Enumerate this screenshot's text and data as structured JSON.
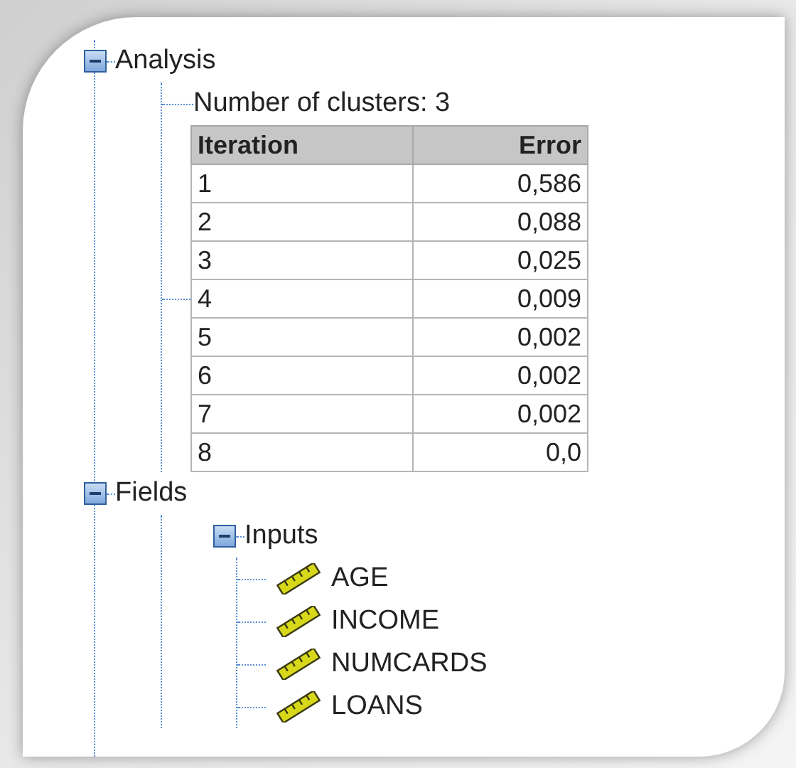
{
  "tree": [
    {
      "label": "Analysis",
      "expanded": true,
      "children": [
        {
          "kind": "text",
          "label": "Number of clusters: 3"
        },
        {
          "kind": "table",
          "columns": [
            "Iteration",
            "Error"
          ],
          "rows": [
            [
              "1",
              "0,586"
            ],
            [
              "2",
              "0,088"
            ],
            [
              "3",
              "0,025"
            ],
            [
              "4",
              "0,009"
            ],
            [
              "5",
              "0,002"
            ],
            [
              "6",
              "0,002"
            ],
            [
              "7",
              "0,002"
            ],
            [
              "8",
              "0,0"
            ]
          ]
        }
      ]
    },
    {
      "label": "Fields",
      "expanded": true,
      "children": [
        {
          "kind": "folder",
          "label": "Inputs",
          "expanded": true,
          "children": [
            {
              "kind": "field",
              "label": "AGE"
            },
            {
              "kind": "field",
              "label": "INCOME"
            },
            {
              "kind": "field",
              "label": "NUMCARDS"
            },
            {
              "kind": "field",
              "label": "LOANS"
            }
          ]
        }
      ]
    }
  ]
}
